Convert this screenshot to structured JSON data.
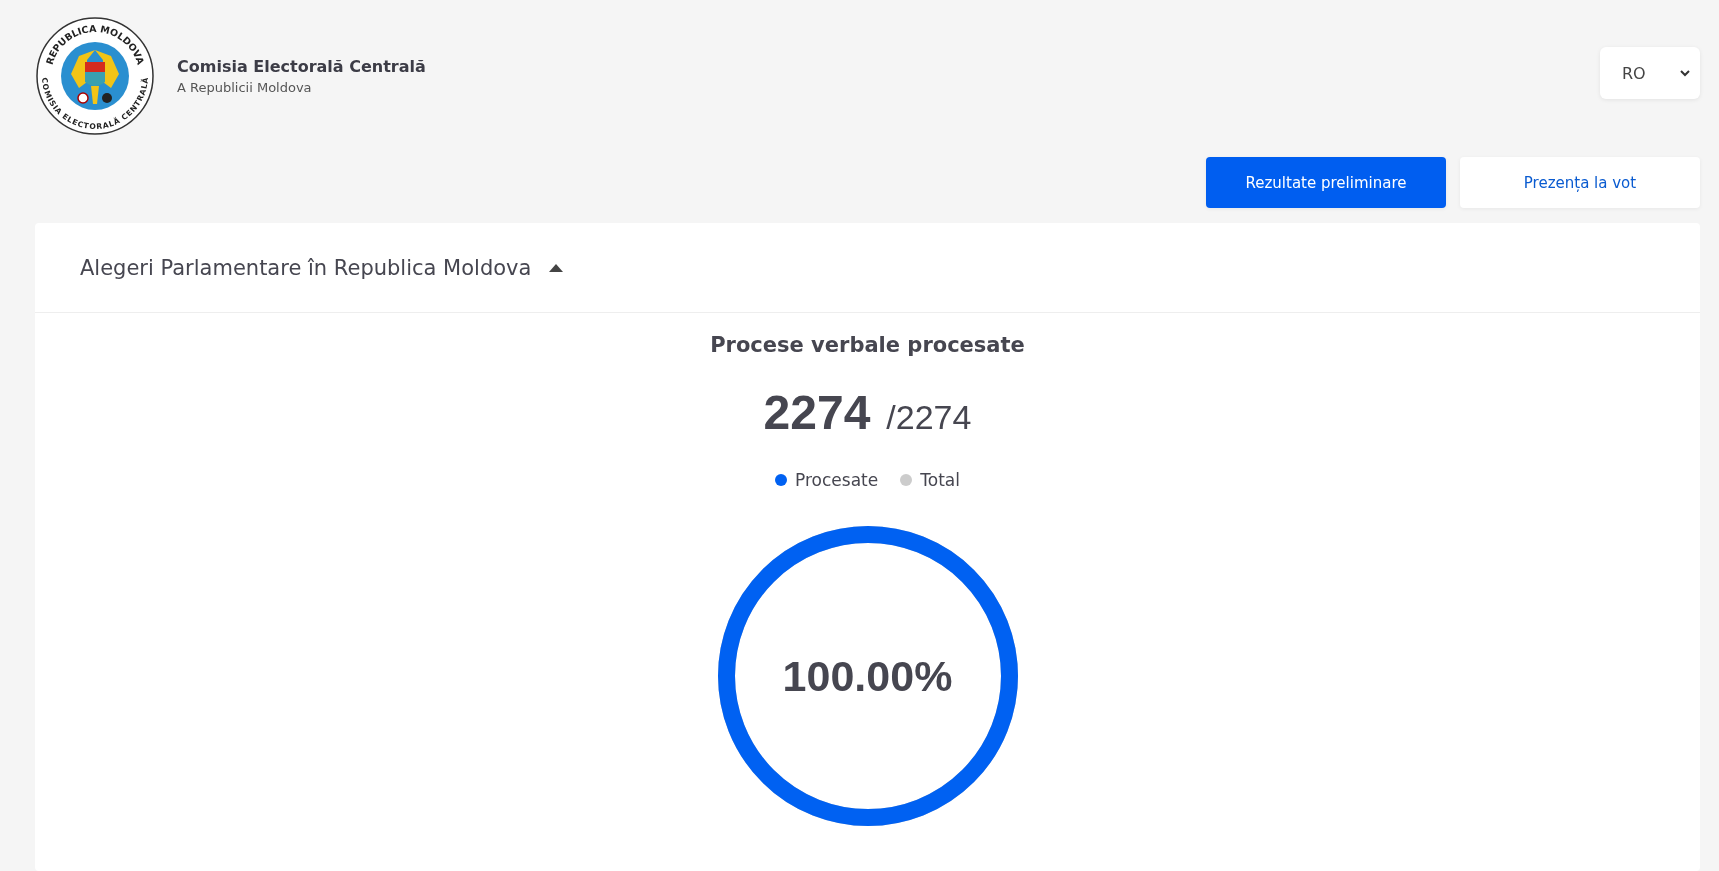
{
  "logo": {
    "top_text": "REPUBLICA MOLDOVA",
    "bottom_text": "COMISIA ELECTORALĂ CENTRALĂ"
  },
  "header": {
    "title": "Comisia Electorală Centrală",
    "subtitle": "A Republicii Moldova"
  },
  "language_select": {
    "value": "RO"
  },
  "nav_buttons": [
    {
      "label": "Rezultate preliminare",
      "selected": true
    },
    {
      "label": "Prezența la vot",
      "selected": false
    }
  ],
  "panel": {
    "title": "Alegeri Parlamentare în Republica Moldova",
    "expanded": true,
    "section_title": "Procese verbale procesate",
    "count": "2274",
    "total": "/2274",
    "center_label": "100.00%",
    "legend": [
      {
        "label": "Procesate",
        "color": "#0061f2"
      },
      {
        "label": "Total",
        "color": "#cccccc"
      }
    ]
  }
}
